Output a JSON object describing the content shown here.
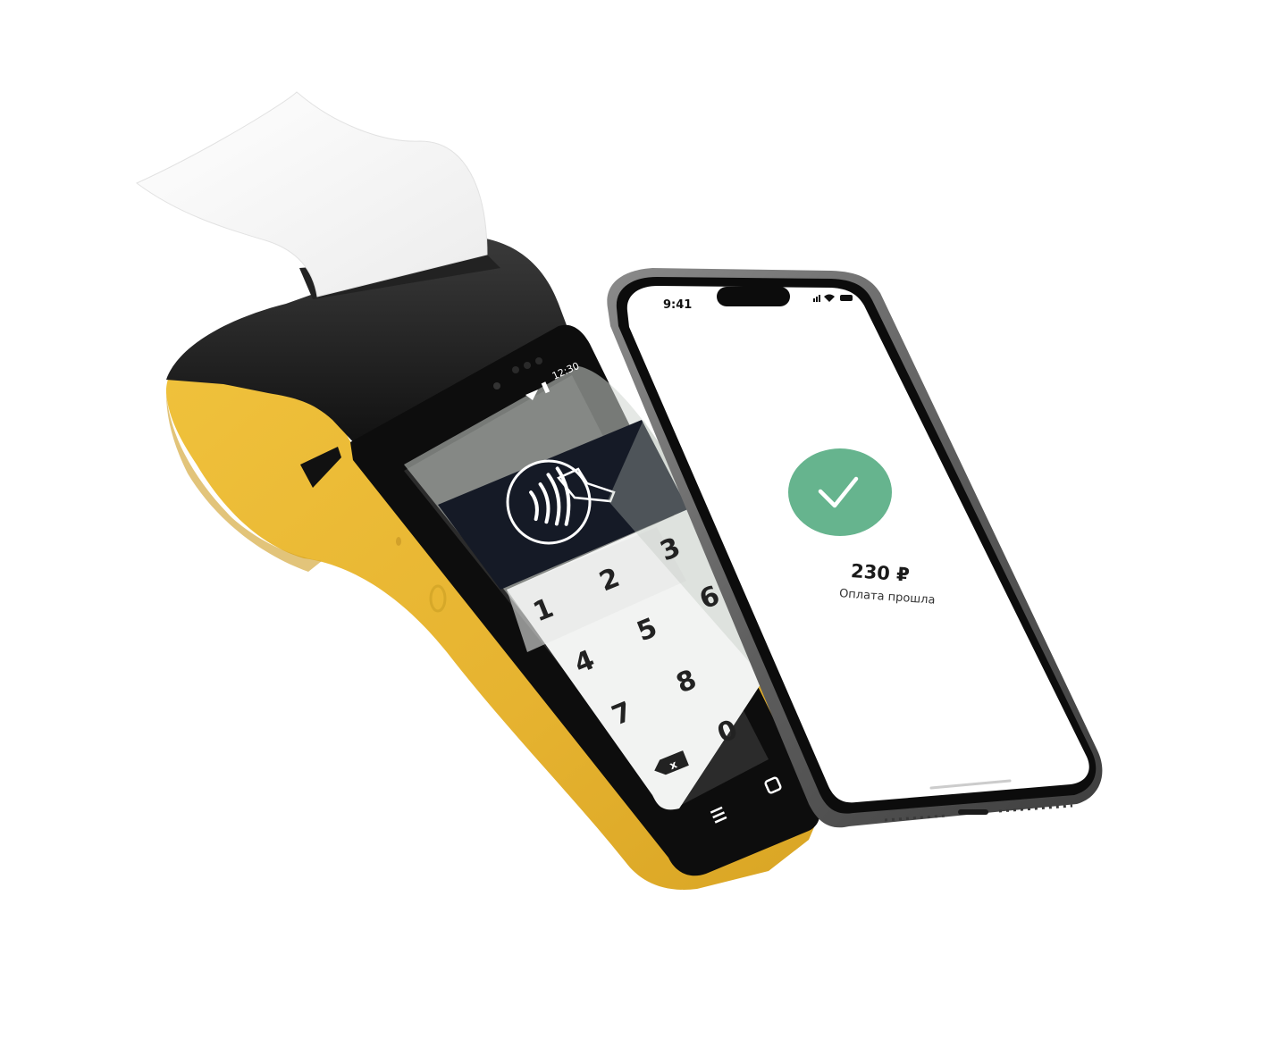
{
  "pos_terminal": {
    "status_time": "12:30",
    "keypad_keys": [
      "1",
      "2",
      "3",
      "4",
      "5",
      "6",
      "7",
      "8",
      "0"
    ],
    "backspace_label": "x",
    "colors": {
      "body": "#E6B530",
      "screen": "#111111",
      "paper": "#ffffff"
    }
  },
  "phone": {
    "status_time": "9:41",
    "amount": "230 ₽",
    "message": "Оплата прошла",
    "success_icon": "check-icon",
    "colors": {
      "success": "#66B48E",
      "frame": "#6e6e6e"
    }
  }
}
